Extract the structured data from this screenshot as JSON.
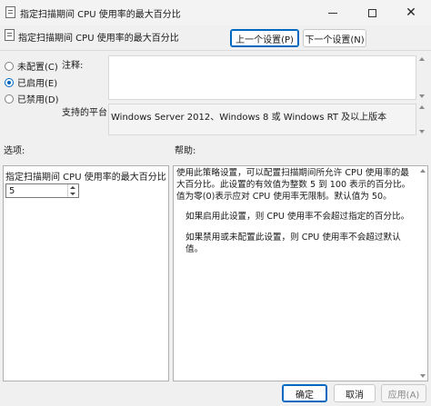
{
  "window": {
    "title": "指定扫描期间 CPU 使用率的最大百分比",
    "controls": [
      "minimize-icon",
      "maximize-icon",
      "close-icon"
    ],
    "close_glyph": "✕"
  },
  "header": {
    "title": "指定扫描期间 CPU 使用率的最大百分比",
    "prev_button": "上一个设置(P)",
    "next_button": "下一个设置(N)"
  },
  "state_options": [
    {
      "label": "未配置(C)",
      "checked": false
    },
    {
      "label": "已启用(E)",
      "checked": true
    },
    {
      "label": "已禁用(D)",
      "checked": false
    }
  ],
  "comment": {
    "label": "注释:",
    "value": ""
  },
  "supported": {
    "label": "支持的平台:",
    "value": "Windows Server 2012、Windows 8 或 Windows RT 及以上版本"
  },
  "options": {
    "label": "选项:",
    "field_label": "指定扫描期间 CPU 使用率的最大百分比",
    "value": "5"
  },
  "help": {
    "label": "帮助:",
    "paragraphs": [
      "使用此策略设置，可以配置扫描期间所允许 CPU 使用率的最大百分比。此设置的有效值为整数 5 到 100 表示的百分比。值为零(0)表示应对 CPU 使用率无限制。默认值为 50。",
      "如果启用此设置，则 CPU 使用率不会超过指定的百分比。",
      "如果禁用或未配置此设置，则 CPU 使用率不会超过默认值。"
    ]
  },
  "footer": {
    "ok": "确定",
    "cancel": "取消",
    "apply": "应用(A)"
  },
  "colors": {
    "accent": "#0067c0",
    "background": "#f0f0f0"
  }
}
